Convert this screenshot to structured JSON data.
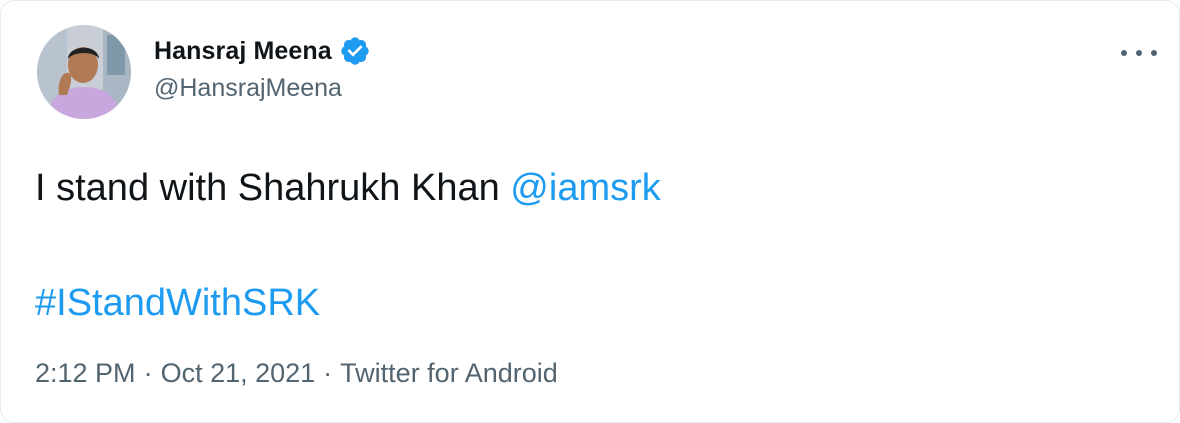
{
  "author": {
    "display_name": "Hansraj Meena",
    "handle": "@HansrajMeena",
    "verified": true
  },
  "menu": {
    "icon": "more-horizontal-icon"
  },
  "tweet": {
    "text_prefix": "I stand with Shahrukh Khan ",
    "mention": "@iamsrk",
    "hashtag": "#IStandWithSRK"
  },
  "meta": {
    "time": "2:12 PM",
    "separator": "·",
    "date": "Oct 21, 2021",
    "source": "Twitter for Android"
  },
  "colors": {
    "link": "#1d9bf0",
    "verified": "#1d9bf0",
    "secondary_text": "#536471",
    "primary_text": "#0f1419"
  }
}
